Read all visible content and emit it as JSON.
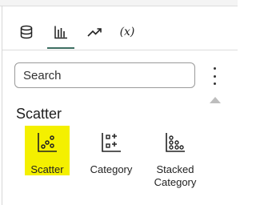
{
  "tabs": [
    {
      "name": "data",
      "icon": "database-icon",
      "active": false
    },
    {
      "name": "visualizations",
      "icon": "bar-chart-icon",
      "active": true
    },
    {
      "name": "analytics",
      "icon": "trend-icon",
      "active": false
    },
    {
      "name": "calculations",
      "icon": "function-icon",
      "label": "(x)",
      "active": false
    }
  ],
  "search": {
    "placeholder": "Search"
  },
  "section": {
    "title": "Scatter"
  },
  "tiles": [
    {
      "label": "Scatter",
      "icon": "scatter-chart-icon",
      "selected": true
    },
    {
      "label": "Category",
      "icon": "category-scatter-icon",
      "selected": false
    },
    {
      "label": "Stacked Category",
      "icon": "stacked-category-scatter-icon",
      "selected": false
    }
  ],
  "colors": {
    "highlight": "#f4f000",
    "active_tab_underline": "#3c6e61"
  }
}
